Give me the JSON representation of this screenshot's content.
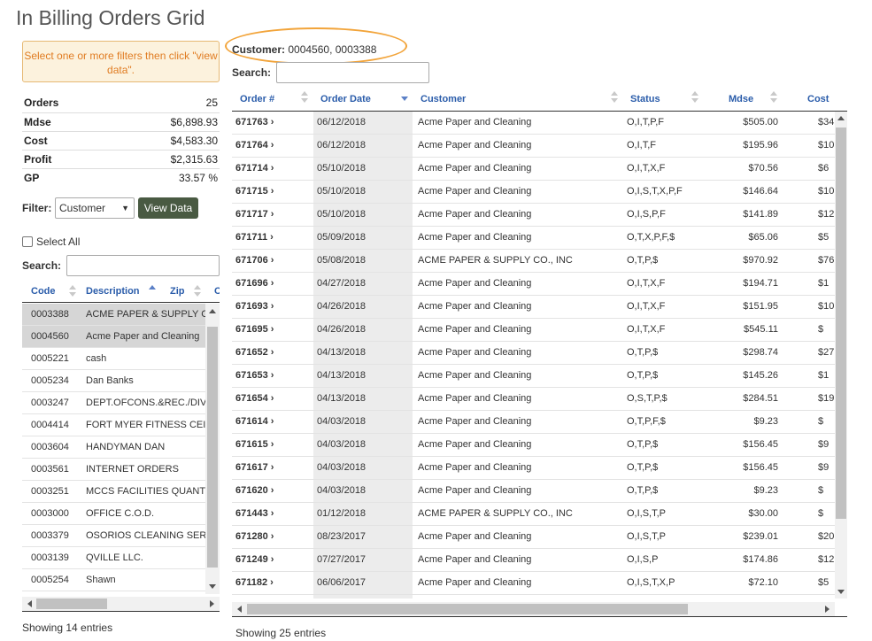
{
  "page": {
    "title": "In Billing Orders Grid"
  },
  "hint": {
    "text": "Select one or more filters then click \"view data\"."
  },
  "summary": [
    {
      "label": "Orders",
      "value": "25"
    },
    {
      "label": "Mdse",
      "value": "$6,898.93"
    },
    {
      "label": "Cost",
      "value": "$4,583.30"
    },
    {
      "label": "Profit",
      "value": "$2,315.63"
    },
    {
      "label": "GP",
      "value": "33.57 %"
    }
  ],
  "filter": {
    "label": "Filter:",
    "selected": "Customer",
    "button": "View Data"
  },
  "select_all": {
    "label": "Select All",
    "checked": false
  },
  "customer_search": {
    "label": "Search:",
    "value": ""
  },
  "customer_table": {
    "columns": [
      "Code",
      "Description",
      "Zip",
      "C"
    ],
    "rows": [
      {
        "code": "0003388",
        "description": "ACME PAPER & SUPPLY C",
        "selected": true
      },
      {
        "code": "0004560",
        "description": "Acme Paper and Cleaning",
        "selected": true
      },
      {
        "code": "0005221",
        "description": "cash",
        "selected": false
      },
      {
        "code": "0005234",
        "description": "Dan Banks",
        "selected": false
      },
      {
        "code": "0003247",
        "description": "DEPT.OFCONS.&REC./DIV",
        "selected": false
      },
      {
        "code": "0004414",
        "description": "FORT MYER FITNESS CEI",
        "selected": false
      },
      {
        "code": "0003604",
        "description": "HANDYMAN DAN",
        "selected": false
      },
      {
        "code": "0003561",
        "description": "INTERNET ORDERS",
        "selected": false
      },
      {
        "code": "0003251",
        "description": "MCCS FACILITIES QUANT",
        "selected": false
      },
      {
        "code": "0003000",
        "description": "OFFICE C.O.D.",
        "selected": false
      },
      {
        "code": "0003379",
        "description": "OSORIOS CLEANING SER",
        "selected": false
      },
      {
        "code": "0003139",
        "description": "QVILLE LLC.",
        "selected": false
      },
      {
        "code": "0005254",
        "description": "Shawn",
        "selected": false
      }
    ],
    "showing": "Showing 14 entries"
  },
  "customer_filter": {
    "label": "Customer:",
    "value": "0004560, 0003388"
  },
  "orders_search": {
    "label": "Search:",
    "value": ""
  },
  "orders_table": {
    "columns": [
      "Order #",
      "Order Date",
      "Customer",
      "Status",
      "Mdse",
      "Cost"
    ],
    "rows": [
      {
        "order": "671763 ›",
        "date": "06/12/2018",
        "customer": "Acme Paper and Cleaning",
        "status": "O,I,T,P,F",
        "mdse": "$505.00",
        "cost": "$34"
      },
      {
        "order": "671764 ›",
        "date": "06/12/2018",
        "customer": "Acme Paper and Cleaning",
        "status": "O,I,T,F",
        "mdse": "$195.96",
        "cost": "$10"
      },
      {
        "order": "671714 ›",
        "date": "05/10/2018",
        "customer": "Acme Paper and Cleaning",
        "status": "O,I,T,X,F",
        "mdse": "$70.56",
        "cost": "$6"
      },
      {
        "order": "671715 ›",
        "date": "05/10/2018",
        "customer": "Acme Paper and Cleaning",
        "status": "O,I,S,T,X,P,F",
        "mdse": "$146.64",
        "cost": "$10"
      },
      {
        "order": "671717 ›",
        "date": "05/10/2018",
        "customer": "Acme Paper and Cleaning",
        "status": "O,I,S,P,F",
        "mdse": "$141.89",
        "cost": "$12"
      },
      {
        "order": "671711 ›",
        "date": "05/09/2018",
        "customer": "Acme Paper and Cleaning",
        "status": "O,T,X,P,F,$",
        "mdse": "$65.06",
        "cost": "$5"
      },
      {
        "order": "671706 ›",
        "date": "05/08/2018",
        "customer": "ACME PAPER & SUPPLY CO., INC",
        "status": "O,T,P,$",
        "mdse": "$970.92",
        "cost": "$76"
      },
      {
        "order": "671696 ›",
        "date": "04/27/2018",
        "customer": "Acme Paper and Cleaning",
        "status": "O,I,T,X,F",
        "mdse": "$194.71",
        "cost": "$1"
      },
      {
        "order": "671693 ›",
        "date": "04/26/2018",
        "customer": "Acme Paper and Cleaning",
        "status": "O,I,T,X,F",
        "mdse": "$151.95",
        "cost": "$10"
      },
      {
        "order": "671695 ›",
        "date": "04/26/2018",
        "customer": "Acme Paper and Cleaning",
        "status": "O,I,T,X,F",
        "mdse": "$545.11",
        "cost": "$"
      },
      {
        "order": "671652 ›",
        "date": "04/13/2018",
        "customer": "Acme Paper and Cleaning",
        "status": "O,T,P,$",
        "mdse": "$298.74",
        "cost": "$27"
      },
      {
        "order": "671653 ›",
        "date": "04/13/2018",
        "customer": "Acme Paper and Cleaning",
        "status": "O,T,P,$",
        "mdse": "$145.26",
        "cost": "$1"
      },
      {
        "order": "671654 ›",
        "date": "04/13/2018",
        "customer": "Acme Paper and Cleaning",
        "status": "O,S,T,P,$",
        "mdse": "$284.51",
        "cost": "$19"
      },
      {
        "order": "671614 ›",
        "date": "04/03/2018",
        "customer": "Acme Paper and Cleaning",
        "status": "O,T,P,F,$",
        "mdse": "$9.23",
        "cost": "$"
      },
      {
        "order": "671615 ›",
        "date": "04/03/2018",
        "customer": "Acme Paper and Cleaning",
        "status": "O,T,P,$",
        "mdse": "$156.45",
        "cost": "$9"
      },
      {
        "order": "671617 ›",
        "date": "04/03/2018",
        "customer": "Acme Paper and Cleaning",
        "status": "O,T,P,$",
        "mdse": "$156.45",
        "cost": "$9"
      },
      {
        "order": "671620 ›",
        "date": "04/03/2018",
        "customer": "Acme Paper and Cleaning",
        "status": "O,T,P,$",
        "mdse": "$9.23",
        "cost": "$"
      },
      {
        "order": "671443 ›",
        "date": "01/12/2018",
        "customer": "ACME PAPER & SUPPLY CO., INC",
        "status": "O,I,S,T,P",
        "mdse": "$30.00",
        "cost": "$"
      },
      {
        "order": "671280 ›",
        "date": "08/23/2017",
        "customer": "Acme Paper and Cleaning",
        "status": "O,I,S,T,P",
        "mdse": "$239.01",
        "cost": "$20"
      },
      {
        "order": "671249 ›",
        "date": "07/27/2017",
        "customer": "Acme Paper and Cleaning",
        "status": "O,I,S,P",
        "mdse": "$174.86",
        "cost": "$12"
      },
      {
        "order": "671182 ›",
        "date": "06/06/2017",
        "customer": "Acme Paper and Cleaning",
        "status": "O,I,S,T,X,P",
        "mdse": "$72.10",
        "cost": "$5"
      }
    ],
    "showing": "Showing 25 entries"
  },
  "colors": {
    "accent": "#2a5caa",
    "button": "#495a42",
    "hint_bg": "#fcf2dd",
    "hint_text": "#e07c22",
    "highlight": "#f2a43a"
  }
}
